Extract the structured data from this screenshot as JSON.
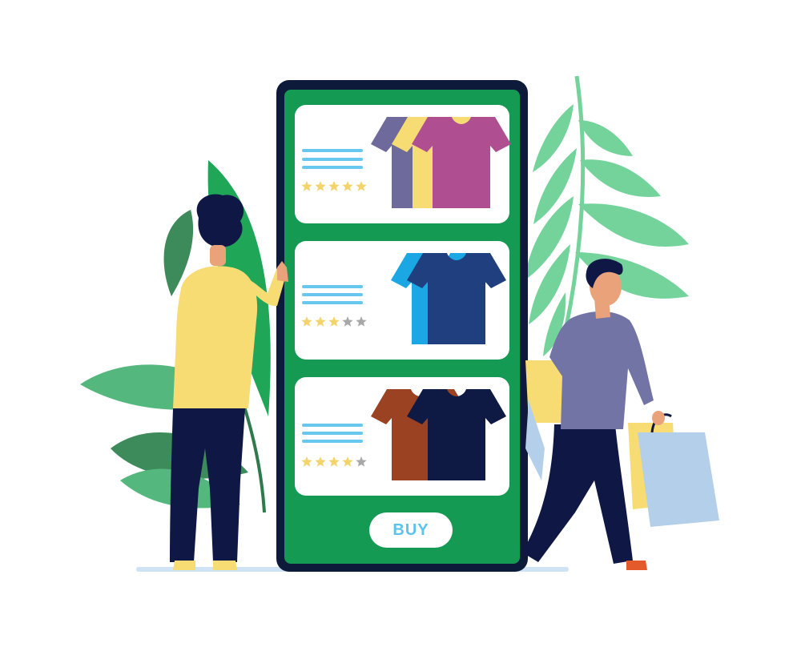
{
  "colors": {
    "phone_frame": "#0e1a3a",
    "phone_screen": "#149a52",
    "card": "#ffffff",
    "text_lines": "#67c7ee",
    "star_filled": "#f3d36b",
    "star_empty": "#a8a8a8",
    "leaf_light": "#73d39b",
    "leaf_mid": "#54b87e",
    "leaf_dark": "#3d8a5a",
    "leaf_green": "#1fa657",
    "shirt_person_top": "#f6dc73",
    "shirt_person_right": "#7274a6",
    "pants": "#0f1844",
    "bag_yellow": "#f6dc73",
    "bag_blue": "#b4cfea"
  },
  "products": [
    {
      "rating": 5,
      "shirt_colors": [
        "#6e6b9c",
        "#f6dc73",
        "#b04e92"
      ]
    },
    {
      "rating": 3,
      "shirt_colors": [
        "#1aa7e4",
        "#1f3f7f"
      ]
    },
    {
      "rating": 4,
      "shirt_colors": [
        "#9a4222",
        "#0e1a44"
      ]
    }
  ],
  "buy_label": "BUY"
}
